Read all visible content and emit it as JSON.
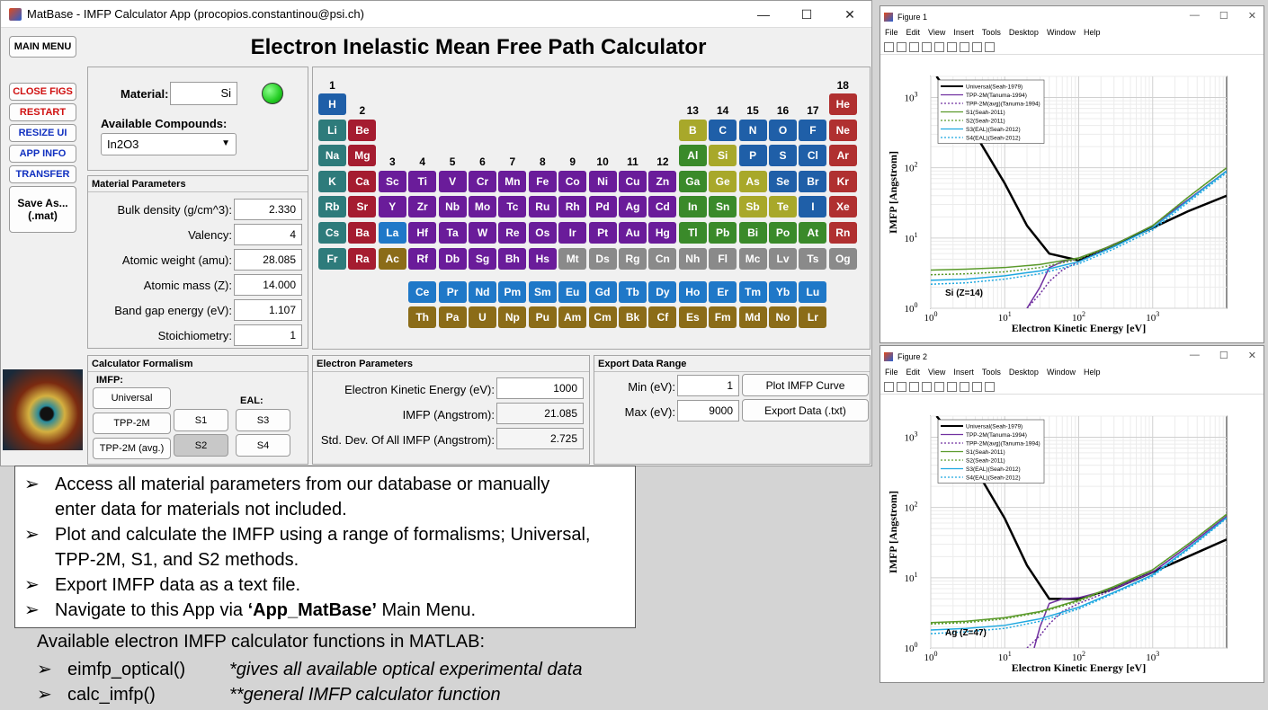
{
  "app": {
    "window_title": "MatBase - IMFP Calculator App (procopios.constantinou@psi.ch)",
    "heading": "Electron Inelastic Mean Free Path Calculator",
    "win_min": "—",
    "win_max": "☐",
    "win_close": "✕"
  },
  "sidebar": {
    "main_menu": "MAIN MENU",
    "close_figs": "CLOSE FIGS",
    "restart": "RESTART",
    "resize_ui": "RESIZE UI",
    "app_info": "APP INFO",
    "transfer": "TRANSFER",
    "save_as_line1": "Save As...",
    "save_as_line2": "(.mat)"
  },
  "material": {
    "label": "Material:",
    "value": "Si",
    "compounds_label": "Available Compounds:",
    "compound_selected": "In2O3",
    "status_color": "#22cc22"
  },
  "material_params": {
    "title": "Material Parameters",
    "rows": [
      {
        "label": "Bulk density (g/cm^3):",
        "value": "2.330"
      },
      {
        "label": "Valency:",
        "value": "4"
      },
      {
        "label": "Atomic weight (amu):",
        "value": "28.085"
      },
      {
        "label": "Atomic mass (Z):",
        "value": "14.000"
      },
      {
        "label": "Band gap energy (eV):",
        "value": "1.107"
      },
      {
        "label": "Stoichiometry:",
        "value": "1"
      }
    ]
  },
  "formalism": {
    "title": "Calculator Formalism",
    "imfp_label": "IMFP:",
    "eal_label": "EAL:",
    "universal": "Universal",
    "tpp2m": "TPP-2M",
    "tpp2m_avg": "TPP-2M (avg.)",
    "s1": "S1",
    "s2": "S2",
    "s3": "S3",
    "s4": "S4"
  },
  "electron_params": {
    "title": "Electron Parameters",
    "rows": [
      {
        "label": "Electron Kinetic Energy (eV):",
        "value": "1000"
      },
      {
        "label": "IMFP (Angstrom):",
        "value": "21.085"
      },
      {
        "label": "Std. Dev. Of All IMFP (Angstrom):",
        "value": "2.725"
      }
    ]
  },
  "export": {
    "title": "Export Data Range",
    "min_label": "Min (eV):",
    "min_value": "1",
    "max_label": "Max (eV):",
    "max_value": "9000",
    "plot_button": "Plot IMFP Curve",
    "export_button": "Export Data (.txt)"
  },
  "periodic_table": {
    "colors": {
      "H": "#1f5fa8",
      "alkali": "#2e7b7b",
      "alkaline": "#a51c30",
      "lanthanide": "#8b6c18",
      "transition": "#6a1c9a",
      "nonmetal": "#1f5fa8",
      "post": "#3a8a2a",
      "metalloid": "#a8a82a",
      "noble": "#b03030",
      "unknown": "#8a8a8a",
      "lanth_row": "#1f78c8",
      "actin_row": "#8b6c18",
      "sc": "#6a1c9a",
      "la": "#1f78c8"
    },
    "group_numbers": [
      "1",
      "2",
      "3",
      "4",
      "5",
      "6",
      "7",
      "8",
      "9",
      "10",
      "11",
      "12",
      "13",
      "14",
      "15",
      "16",
      "17",
      "18"
    ],
    "elements": [
      {
        "s": "H",
        "c": "#1f5fa8"
      },
      {
        "s": "He",
        "c": "#b03030"
      },
      {
        "s": "Li",
        "c": "#2e7b7b"
      },
      {
        "s": "Be",
        "c": "#a51c30"
      },
      {
        "s": "B",
        "c": "#a8a82a"
      },
      {
        "s": "C",
        "c": "#1f5fa8"
      },
      {
        "s": "N",
        "c": "#1f5fa8"
      },
      {
        "s": "O",
        "c": "#1f5fa8"
      },
      {
        "s": "F",
        "c": "#1f5fa8"
      },
      {
        "s": "Ne",
        "c": "#b03030"
      },
      {
        "s": "Na",
        "c": "#2e7b7b"
      },
      {
        "s": "Mg",
        "c": "#a51c30"
      },
      {
        "s": "Al",
        "c": "#3a8a2a"
      },
      {
        "s": "Si",
        "c": "#a8a82a"
      },
      {
        "s": "P",
        "c": "#1f5fa8"
      },
      {
        "s": "S",
        "c": "#1f5fa8"
      },
      {
        "s": "Cl",
        "c": "#1f5fa8"
      },
      {
        "s": "Ar",
        "c": "#b03030"
      },
      {
        "s": "K",
        "c": "#2e7b7b"
      },
      {
        "s": "Ca",
        "c": "#a51c30"
      },
      {
        "s": "Sc",
        "c": "#6a1c9a"
      },
      {
        "s": "Ti",
        "c": "#6a1c9a"
      },
      {
        "s": "V",
        "c": "#6a1c9a"
      },
      {
        "s": "Cr",
        "c": "#6a1c9a"
      },
      {
        "s": "Mn",
        "c": "#6a1c9a"
      },
      {
        "s": "Fe",
        "c": "#6a1c9a"
      },
      {
        "s": "Co",
        "c": "#6a1c9a"
      },
      {
        "s": "Ni",
        "c": "#6a1c9a"
      },
      {
        "s": "Cu",
        "c": "#6a1c9a"
      },
      {
        "s": "Zn",
        "c": "#6a1c9a"
      },
      {
        "s": "Ga",
        "c": "#3a8a2a"
      },
      {
        "s": "Ge",
        "c": "#a8a82a"
      },
      {
        "s": "As",
        "c": "#a8a82a"
      },
      {
        "s": "Se",
        "c": "#1f5fa8"
      },
      {
        "s": "Br",
        "c": "#1f5fa8"
      },
      {
        "s": "Kr",
        "c": "#b03030"
      },
      {
        "s": "Rb",
        "c": "#2e7b7b"
      },
      {
        "s": "Sr",
        "c": "#a51c30"
      },
      {
        "s": "Y",
        "c": "#6a1c9a"
      },
      {
        "s": "Zr",
        "c": "#6a1c9a"
      },
      {
        "s": "Nb",
        "c": "#6a1c9a"
      },
      {
        "s": "Mo",
        "c": "#6a1c9a"
      },
      {
        "s": "Tc",
        "c": "#6a1c9a"
      },
      {
        "s": "Ru",
        "c": "#6a1c9a"
      },
      {
        "s": "Rh",
        "c": "#6a1c9a"
      },
      {
        "s": "Pd",
        "c": "#6a1c9a"
      },
      {
        "s": "Ag",
        "c": "#6a1c9a"
      },
      {
        "s": "Cd",
        "c": "#6a1c9a"
      },
      {
        "s": "In",
        "c": "#3a8a2a"
      },
      {
        "s": "Sn",
        "c": "#3a8a2a"
      },
      {
        "s": "Sb",
        "c": "#a8a82a"
      },
      {
        "s": "Te",
        "c": "#a8a82a"
      },
      {
        "s": "I",
        "c": "#1f5fa8"
      },
      {
        "s": "Xe",
        "c": "#b03030"
      },
      {
        "s": "Cs",
        "c": "#2e7b7b"
      },
      {
        "s": "Ba",
        "c": "#a51c30"
      },
      {
        "s": "La",
        "c": "#1f78c8"
      },
      {
        "s": "Hf",
        "c": "#6a1c9a"
      },
      {
        "s": "Ta",
        "c": "#6a1c9a"
      },
      {
        "s": "W",
        "c": "#6a1c9a"
      },
      {
        "s": "Re",
        "c": "#6a1c9a"
      },
      {
        "s": "Os",
        "c": "#6a1c9a"
      },
      {
        "s": "Ir",
        "c": "#6a1c9a"
      },
      {
        "s": "Pt",
        "c": "#6a1c9a"
      },
      {
        "s": "Au",
        "c": "#6a1c9a"
      },
      {
        "s": "Hg",
        "c": "#6a1c9a"
      },
      {
        "s": "Tl",
        "c": "#3a8a2a"
      },
      {
        "s": "Pb",
        "c": "#3a8a2a"
      },
      {
        "s": "Bi",
        "c": "#3a8a2a"
      },
      {
        "s": "Po",
        "c": "#3a8a2a"
      },
      {
        "s": "At",
        "c": "#3a8a2a"
      },
      {
        "s": "Rn",
        "c": "#b03030"
      },
      {
        "s": "Fr",
        "c": "#2e7b7b"
      },
      {
        "s": "Ra",
        "c": "#a51c30"
      },
      {
        "s": "Ac",
        "c": "#8b6c18"
      },
      {
        "s": "Rf",
        "c": "#6a1c9a"
      },
      {
        "s": "Db",
        "c": "#6a1c9a"
      },
      {
        "s": "Sg",
        "c": "#6a1c9a"
      },
      {
        "s": "Bh",
        "c": "#6a1c9a"
      },
      {
        "s": "Hs",
        "c": "#6a1c9a"
      },
      {
        "s": "Mt",
        "c": "#8a8a8a"
      },
      {
        "s": "Ds",
        "c": "#8a8a8a"
      },
      {
        "s": "Rg",
        "c": "#8a8a8a"
      },
      {
        "s": "Cn",
        "c": "#8a8a8a"
      },
      {
        "s": "Nh",
        "c": "#8a8a8a"
      },
      {
        "s": "Fl",
        "c": "#8a8a8a"
      },
      {
        "s": "Mc",
        "c": "#8a8a8a"
      },
      {
        "s": "Lv",
        "c": "#8a8a8a"
      },
      {
        "s": "Ts",
        "c": "#8a8a8a"
      },
      {
        "s": "Og",
        "c": "#8a8a8a"
      },
      {
        "s": "Ce",
        "c": "#1f78c8"
      },
      {
        "s": "Pr",
        "c": "#1f78c8"
      },
      {
        "s": "Nd",
        "c": "#1f78c8"
      },
      {
        "s": "Pm",
        "c": "#1f78c8"
      },
      {
        "s": "Sm",
        "c": "#1f78c8"
      },
      {
        "s": "Eu",
        "c": "#1f78c8"
      },
      {
        "s": "Gd",
        "c": "#1f78c8"
      },
      {
        "s": "Tb",
        "c": "#1f78c8"
      },
      {
        "s": "Dy",
        "c": "#1f78c8"
      },
      {
        "s": "Ho",
        "c": "#1f78c8"
      },
      {
        "s": "Er",
        "c": "#1f78c8"
      },
      {
        "s": "Tm",
        "c": "#1f78c8"
      },
      {
        "s": "Yb",
        "c": "#1f78c8"
      },
      {
        "s": "Lu",
        "c": "#1f78c8"
      },
      {
        "s": "Th",
        "c": "#8b6c18"
      },
      {
        "s": "Pa",
        "c": "#8b6c18"
      },
      {
        "s": "U",
        "c": "#8b6c18"
      },
      {
        "s": "Np",
        "c": "#8b6c18"
      },
      {
        "s": "Pu",
        "c": "#8b6c18"
      },
      {
        "s": "Am",
        "c": "#8b6c18"
      },
      {
        "s": "Cm",
        "c": "#8b6c18"
      },
      {
        "s": "Bk",
        "c": "#8b6c18"
      },
      {
        "s": "Cf",
        "c": "#8b6c18"
      },
      {
        "s": "Es",
        "c": "#8b6c18"
      },
      {
        "s": "Fm",
        "c": "#8b6c18"
      },
      {
        "s": "Md",
        "c": "#8b6c18"
      },
      {
        "s": "No",
        "c": "#8b6c18"
      },
      {
        "s": "Lr",
        "c": "#8b6c18"
      }
    ]
  },
  "notes": {
    "bullets": [
      [
        "Access all material parameters from our database or manually",
        "enter data for materials not included."
      ],
      [
        "Plot and calculate the IMFP using a range of formalisms; Universal,",
        "TPP-2M, S1, and S2 methods."
      ],
      [
        "Export IMFP data as a text file."
      ]
    ],
    "nav_prefix": "Navigate to this App via ",
    "nav_bold": "‘App_MatBase’",
    "nav_suffix": " Main Menu.",
    "functions_heading": "Available electron IMFP calculator functions in MATLAB:",
    "functions": [
      {
        "name": "eimfp_optical()",
        "desc": "*gives all available optical experimental data"
      },
      {
        "name": "calc_imfp()",
        "desc": "**general IMFP calculator function"
      }
    ]
  },
  "figures": [
    {
      "title": "Figure 1",
      "menu": [
        "File",
        "Edit",
        "View",
        "Insert",
        "Tools",
        "Desktop",
        "Window",
        "Help"
      ],
      "annotation": "Si (Z=14)"
    },
    {
      "title": "Figure 2",
      "menu": [
        "File",
        "Edit",
        "View",
        "Insert",
        "Tools",
        "Desktop",
        "Window",
        "Help"
      ],
      "annotation": "Ag (Z=47)"
    }
  ],
  "chart_data": [
    {
      "type": "line",
      "title": "",
      "xlabel": "Electron Kinetic Energy [eV]",
      "ylabel": "IMFP [Angstrom]",
      "xscale": "log",
      "yscale": "log",
      "xlim": [
        1,
        10000
      ],
      "ylim": [
        1,
        2000
      ],
      "x_ticks": [
        "10^0",
        "10^1",
        "10^2",
        "10^3"
      ],
      "y_ticks": [
        "10^0",
        "10^1",
        "10^2",
        "10^3"
      ],
      "grid": true,
      "legend_position": "top-left",
      "series": [
        {
          "name": "Universal(Seah-1979)",
          "color": "#000000",
          "style": "solid",
          "x": [
            1.2,
            3,
            10,
            20,
            40,
            100,
            300,
            1000,
            3000,
            10000
          ],
          "y": [
            2000,
            500,
            60,
            15,
            6,
            4.8,
            8,
            14,
            24,
            40
          ]
        },
        {
          "name": "TPP-2M(Tanuma-1994)",
          "color": "#7030a0",
          "style": "solid",
          "x": [
            20,
            30,
            40,
            60,
            100,
            300,
            1000,
            3000,
            10000
          ],
          "y": [
            1,
            2,
            3.8,
            4.6,
            5.2,
            8,
            15,
            35,
            90
          ]
        },
        {
          "name": "TPP-2M(avg)(Tanuma-1994)",
          "color": "#7030a0",
          "style": "dotted",
          "x": [
            20,
            30,
            40,
            60,
            100,
            300,
            1000,
            3000,
            10000
          ],
          "y": [
            1,
            1.6,
            2.4,
            3.5,
            4.6,
            8,
            15,
            35,
            90
          ]
        },
        {
          "name": "S1(Seah-2011)",
          "color": "#5a9a2a",
          "style": "solid",
          "x": [
            1,
            3,
            10,
            30,
            100,
            300,
            1000,
            3000,
            10000
          ],
          "y": [
            3.5,
            3.6,
            3.8,
            4.2,
            5.2,
            8,
            15,
            38,
            100
          ]
        },
        {
          "name": "S2(Seah-2011)",
          "color": "#5a9a2a",
          "style": "dotted",
          "x": [
            1,
            3,
            10,
            30,
            100,
            300,
            1000,
            3000,
            10000
          ],
          "y": [
            3,
            3.1,
            3.3,
            3.8,
            5,
            8,
            15,
            38,
            100
          ]
        },
        {
          "name": "S3(EAL)(Seah-2012)",
          "color": "#1fa8e0",
          "style": "solid",
          "x": [
            1,
            3,
            10,
            30,
            100,
            300,
            1000,
            3000,
            10000
          ],
          "y": [
            2.5,
            2.6,
            2.9,
            3.4,
            4.6,
            7.5,
            14,
            34,
            90
          ]
        },
        {
          "name": "S4(EAL)(Seah-2012)",
          "color": "#1fa8e0",
          "style": "dotted",
          "x": [
            1,
            3,
            10,
            30,
            100,
            300,
            1000,
            3000,
            10000
          ],
          "y": [
            2.2,
            2.3,
            2.6,
            3.1,
            4.3,
            7,
            13,
            32,
            85
          ]
        }
      ]
    },
    {
      "type": "line",
      "title": "",
      "xlabel": "Electron Kinetic Energy [eV]",
      "ylabel": "IMFP [Angstrom]",
      "xscale": "log",
      "yscale": "log",
      "xlim": [
        1,
        10000
      ],
      "ylim": [
        1,
        2000
      ],
      "x_ticks": [
        "10^0",
        "10^1",
        "10^2",
        "10^3"
      ],
      "y_ticks": [
        "10^0",
        "10^1",
        "10^2",
        "10^3"
      ],
      "grid": true,
      "legend_position": "top-left",
      "series": [
        {
          "name": "Universal(Seah-1979)",
          "color": "#000000",
          "style": "solid",
          "x": [
            1.2,
            3,
            10,
            20,
            40,
            100,
            300,
            1000,
            3000,
            10000
          ],
          "y": [
            2000,
            600,
            70,
            15,
            5,
            5,
            7,
            12,
            20,
            35
          ]
        },
        {
          "name": "TPP-2M(Tanuma-1994)",
          "color": "#7030a0",
          "style": "solid",
          "x": [
            25,
            30,
            40,
            60,
            100,
            300,
            1000,
            3000,
            10000
          ],
          "y": [
            1,
            2,
            4.3,
            5,
            5.2,
            7,
            12,
            28,
            75
          ]
        },
        {
          "name": "TPP-2M(avg)(Tanuma-1994)",
          "color": "#7030a0",
          "style": "dotted",
          "x": [
            20,
            30,
            40,
            60,
            100,
            300,
            1000,
            3000,
            10000
          ],
          "y": [
            1,
            1.5,
            2.2,
            3.3,
            4.3,
            6.8,
            12,
            28,
            75
          ]
        },
        {
          "name": "S1(Seah-2011)",
          "color": "#5a9a2a",
          "style": "solid",
          "x": [
            1,
            3,
            10,
            30,
            100,
            300,
            1000,
            3000,
            10000
          ],
          "y": [
            2.3,
            2.4,
            2.7,
            3.3,
            4.8,
            7.5,
            13,
            30,
            80
          ]
        },
        {
          "name": "S2(Seah-2011)",
          "color": "#5a9a2a",
          "style": "dotted",
          "x": [
            1,
            3,
            10,
            30,
            100,
            300,
            1000,
            3000,
            10000
          ],
          "y": [
            2.2,
            2.3,
            2.6,
            3.2,
            4.6,
            7.3,
            13,
            30,
            80
          ]
        },
        {
          "name": "S3(EAL)(Seah-2012)",
          "color": "#1fa8e0",
          "style": "solid",
          "x": [
            1,
            3,
            10,
            30,
            100,
            300,
            1000,
            3000,
            10000
          ],
          "y": [
            1.8,
            1.9,
            2.1,
            2.6,
            3.8,
            6.2,
            11,
            26,
            72
          ]
        },
        {
          "name": "S4(EAL)(Seah-2012)",
          "color": "#1fa8e0",
          "style": "dotted",
          "x": [
            1,
            3,
            10,
            30,
            100,
            300,
            1000,
            3000,
            10000
          ],
          "y": [
            1.6,
            1.7,
            1.9,
            2.4,
            3.6,
            6,
            10.5,
            25,
            70
          ]
        }
      ]
    }
  ]
}
